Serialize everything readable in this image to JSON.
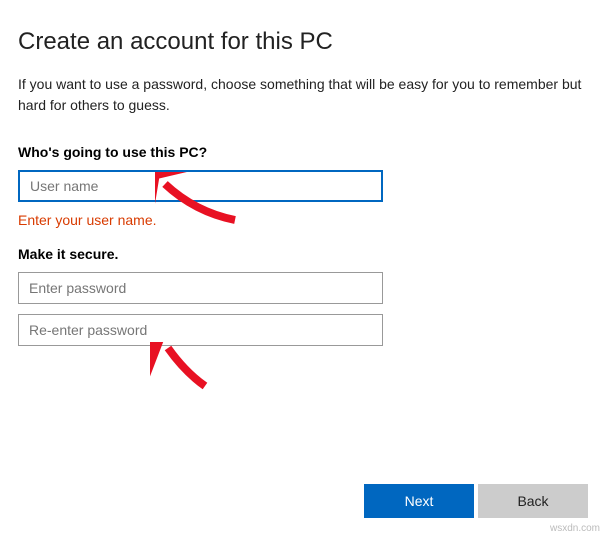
{
  "title": "Create an account for this PC",
  "subtitle": "If you want to use a password, choose something that will be easy for you to remember but hard for others to guess.",
  "username_section": {
    "label": "Who's going to use this PC?",
    "placeholder": "User name",
    "value": "",
    "error": "Enter your user name."
  },
  "password_section": {
    "label": "Make it secure.",
    "password_placeholder": "Enter password",
    "confirm_placeholder": "Re-enter password"
  },
  "buttons": {
    "next": "Next",
    "back": "Back"
  },
  "watermark": "wsxdn.com",
  "colors": {
    "accent": "#0067C0",
    "error": "#D83B01",
    "secondary_btn": "#CCCCCC"
  }
}
